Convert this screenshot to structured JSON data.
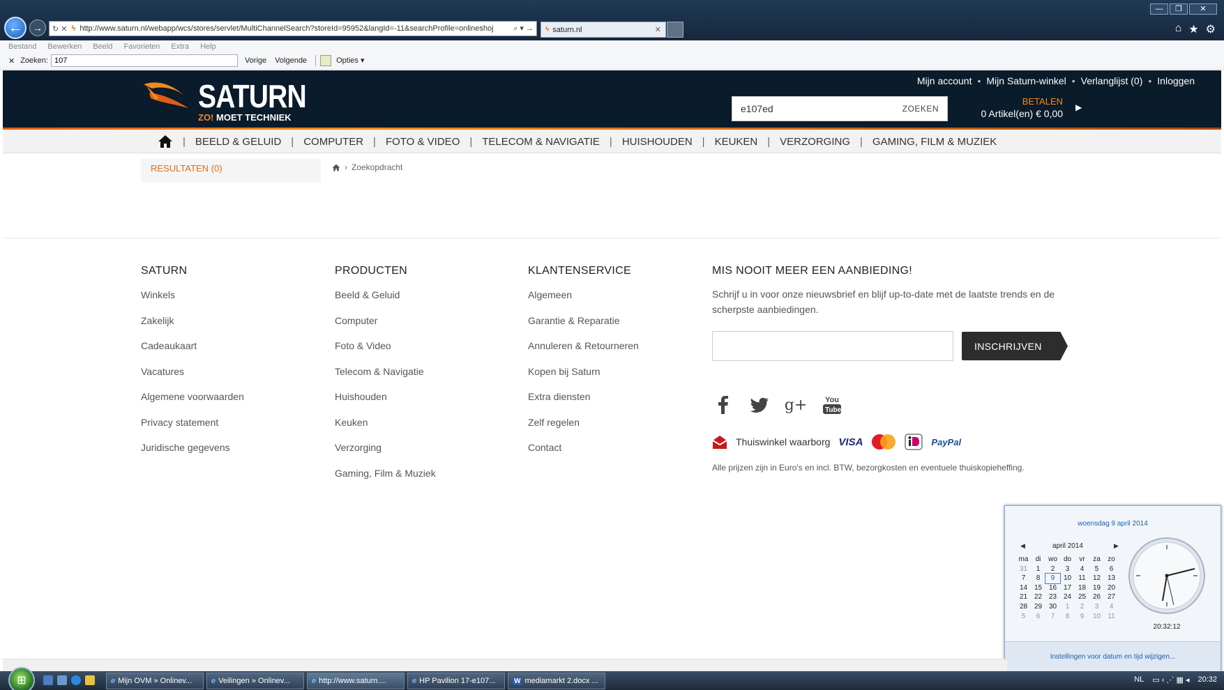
{
  "browser": {
    "url": "http://www.saturn.nl/webapp/wcs/stores/servlet/MultiChannelSearch?storeId=95952&langId=-11&searchProfile=onlineshoj",
    "tab_title": "saturn.nl",
    "menu": [
      "Bestand",
      "Bewerken",
      "Beeld",
      "Favorieten",
      "Extra",
      "Help"
    ],
    "find": {
      "label": "Zoeken:",
      "value": "107",
      "prev": "Vorige",
      "next": "Volgende",
      "options": "Opties"
    }
  },
  "header": {
    "logo_text": "SATURN",
    "tagline_zo": "ZO!",
    "tagline_rest": "MOET TECHNIEK",
    "top_links": [
      "Mijn account",
      "Mijn Saturn-winkel",
      "Verlanglijst (0)",
      "Inloggen"
    ],
    "search_value": "e107ed",
    "search_button": "ZOEKEN",
    "cart_pay": "BETALEN",
    "cart_summary": "0 Artikel(en) € 0,00"
  },
  "nav": {
    "items": [
      "BEELD & GELUID",
      "COMPUTER",
      "FOTO & VIDEO",
      "TELECOM & NAVIGATIE",
      "HUISHOUDEN",
      "KEUKEN",
      "VERZORGING",
      "GAMING, FILM & MUZIEK"
    ]
  },
  "content": {
    "results": "RESULTATEN (0)",
    "breadcrumb": "Zoekopdracht"
  },
  "footer": {
    "saturn": {
      "title": "SATURN",
      "links": [
        "Winkels",
        "Zakelijk",
        "Cadeaukaart",
        "Vacatures",
        "Algemene voorwaarden",
        "Privacy statement",
        "Juridische gegevens"
      ]
    },
    "producten": {
      "title": "PRODUCTEN",
      "links": [
        "Beeld & Geluid",
        "Computer",
        "Foto & Video",
        "Telecom & Navigatie",
        "Huishouden",
        "Keuken",
        "Verzorging",
        "Gaming, Film & Muziek"
      ]
    },
    "klantenservice": {
      "title": "KLANTENSERVICE",
      "links": [
        "Algemeen",
        "Garantie & Reparatie",
        "Annuleren & Retourneren",
        "Kopen bij Saturn",
        "Extra diensten",
        "Zelf regelen",
        "Contact"
      ]
    },
    "newsletter": {
      "title": "MIS NOOIT MEER EEN AANBIEDING!",
      "text": "Schrijf u in voor onze nieuwsbrief en blijf up-to-date met de laatste trends en de scherpste aanbiedingen.",
      "button": "INSCHRIJVEN"
    },
    "social": [
      "facebook-icon",
      "twitter-icon",
      "googleplus-icon",
      "youtube-icon"
    ],
    "thuiswinkel": "Thuiswinkel waarborg",
    "visa": "VISA",
    "paypal": "PayPal",
    "disclaimer": "Alle prijzen zijn in Euro's en incl. BTW, bezorgkosten en eventuele thuiskopieheffing."
  },
  "calendar": {
    "date_long": "woensdag 9 april 2014",
    "month": "april 2014",
    "weekdays": [
      "ma",
      "di",
      "wo",
      "do",
      "vr",
      "za",
      "zo"
    ],
    "days": [
      "31",
      "1",
      "2",
      "3",
      "4",
      "5",
      "6",
      "7",
      "8",
      "9",
      "10",
      "11",
      "12",
      "13",
      "14",
      "15",
      "16",
      "17",
      "18",
      "19",
      "20",
      "21",
      "22",
      "23",
      "24",
      "25",
      "26",
      "27",
      "28",
      "29",
      "30",
      "1",
      "2",
      "3",
      "4",
      "5",
      "6",
      "7",
      "8",
      "9",
      "10",
      "11"
    ],
    "time": "20:32:12",
    "settings_link": "Instellingen voor datum en tijd wijzigen..."
  },
  "taskbar": {
    "items": [
      {
        "icon": "ie",
        "label": "Mijn OVM » Onlinev..."
      },
      {
        "icon": "ie",
        "label": "Veilingen » Onlinev..."
      },
      {
        "icon": "ie",
        "label": "http://www.saturn...."
      },
      {
        "icon": "ie",
        "label": "HP Pavilion 17-e107..."
      },
      {
        "icon": "word",
        "label": "mediamarkt 2.docx ..."
      }
    ],
    "lang": "NL",
    "clock": "20:32"
  }
}
